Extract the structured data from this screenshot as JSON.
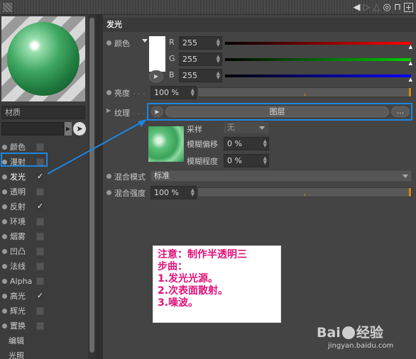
{
  "material": {
    "name_label": "材质"
  },
  "channels": [
    {
      "label": "颜色",
      "checked": false
    },
    {
      "label": "漫射",
      "checked": false
    },
    {
      "label": "发光",
      "checked": true,
      "active": true
    },
    {
      "label": "透明",
      "checked": false
    },
    {
      "label": "反射",
      "checked": true
    },
    {
      "label": "环境",
      "checked": false
    },
    {
      "label": "烟雾",
      "checked": false
    },
    {
      "label": "凹凸",
      "checked": false
    },
    {
      "label": "法线",
      "checked": false
    },
    {
      "label": "Alpha",
      "checked": false
    },
    {
      "label": "高光",
      "checked": true
    },
    {
      "label": "辉光",
      "checked": false
    },
    {
      "label": "置换",
      "checked": false
    },
    {
      "label": "编辑"
    },
    {
      "label": "光照"
    }
  ],
  "check_glyph": "✓",
  "section_title": "发光",
  "color": {
    "label": "颜色",
    "r_label": "R",
    "g_label": "G",
    "b_label": "B",
    "r": "255",
    "g": "255",
    "b": "255",
    "swatch": "#ffffff"
  },
  "brightness": {
    "label": "亮度",
    "dots": ". . .",
    "value": "100 %",
    "level": 1.0
  },
  "texture": {
    "label": "纹理",
    "dots": ". . .",
    "button": "图层",
    "more": "...",
    "sampling_label": "采样",
    "sampling_value": "无",
    "blur_offset_label": "模糊偏移",
    "blur_offset_value": "0 %",
    "blur_scale_label": "模糊程度",
    "blur_scale_value": "0 %"
  },
  "mix_mode": {
    "label": "混合模式",
    "value": "标准"
  },
  "mix_strength": {
    "label": "混合强度",
    "value": "100 %",
    "level": 1.0
  },
  "note": {
    "line1": "注意：制作半透明三",
    "line2": "步曲：",
    "line3": "1.发光光源。",
    "line4": "2.次表面散射。",
    "line5": "3.噪波。"
  },
  "watermark": {
    "brand_left": "Bai",
    "brand_right": "经验",
    "brand_mid": "du",
    "url": "jingyan.baidu.com"
  },
  "colors": {
    "highlight": "#1d86e0",
    "note_text": "#e0127a",
    "accent": "#d38a0a"
  },
  "icons": {
    "back": "◀",
    "lock": "🔓",
    "add": "+"
  }
}
